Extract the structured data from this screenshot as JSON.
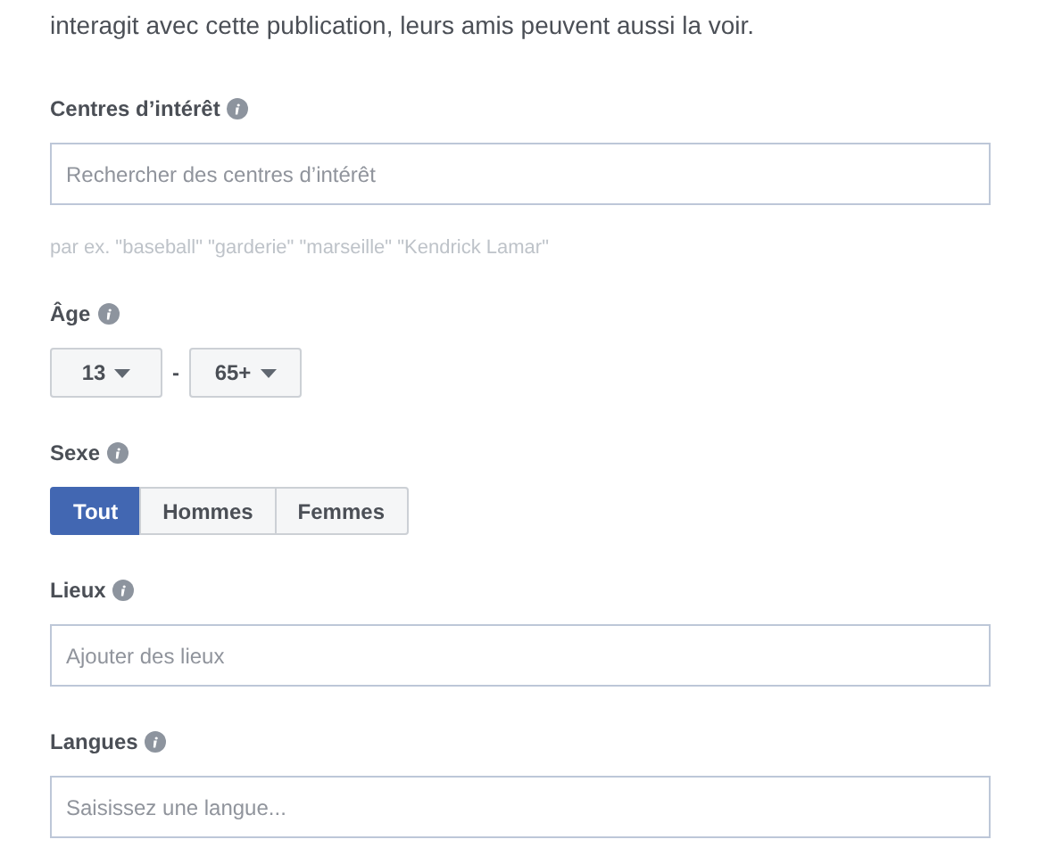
{
  "intro": "interagit avec cette publication, leurs amis peuvent aussi la voir.",
  "sections": [
    {
      "kind": "search",
      "label": "Centres d’intérêt",
      "placeholder": "Rechercher des centres d’intérêt",
      "hint": "par ex. \"baseball\" \"garderie\" \"marseille\" \"Kendrick Lamar\""
    },
    {
      "kind": "range",
      "label": "Âge",
      "from": "13",
      "separator": "-",
      "to": "65+"
    },
    {
      "kind": "segments",
      "label": "Sexe",
      "options": [
        {
          "label": "Tout",
          "selected": true
        },
        {
          "label": "Hommes",
          "selected": false
        },
        {
          "label": "Femmes",
          "selected": false
        }
      ]
    },
    {
      "kind": "search",
      "label": "Lieux",
      "placeholder": "Ajouter des lieux"
    },
    {
      "kind": "search",
      "label": "Langues",
      "placeholder": "Saisissez une langue..."
    }
  ]
}
